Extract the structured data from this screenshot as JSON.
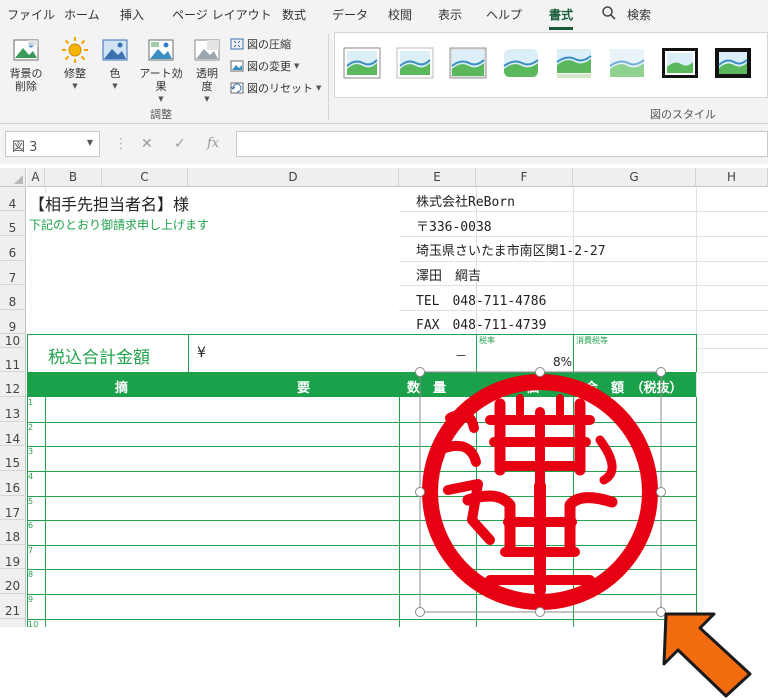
{
  "ribbon": {
    "tabs": [
      "ファイル",
      "ホーム",
      "挿入",
      "ページ レイアウト",
      "数式",
      "データ",
      "校閲",
      "表示",
      "ヘルプ",
      "書式"
    ],
    "search": "検索",
    "buttons": {
      "remove_bg_1": "背景の",
      "remove_bg_2": "削除",
      "corrections": "修整",
      "color": "色",
      "artistic": "アート効果",
      "transparency_1": "透明",
      "transparency_2": "度"
    },
    "small_buttons": [
      "図の圧縮",
      "図の変更",
      "図のリセット"
    ],
    "groups": {
      "adjust": "調整",
      "styles": "図のスタイル"
    }
  },
  "formula_bar": {
    "name_box": "図 3",
    "cancel": "✕",
    "enter": "✓",
    "fx": "fx",
    "formula": ""
  },
  "columns": [
    "A",
    "B",
    "C",
    "D",
    "E",
    "F",
    "G",
    "H"
  ],
  "rows": [
    "4",
    "5",
    "6",
    "7",
    "8",
    "9",
    "10",
    "11",
    "12",
    "13",
    "14",
    "15",
    "16",
    "17",
    "18",
    "19",
    "20",
    "21"
  ],
  "sheet": {
    "recipient": "【相手先担当者名】様",
    "greeting": "下記のとおり御請求申し上げます",
    "company": "株式会社ReBorn",
    "postal": "〒336-0038",
    "address": "埼玉県さいたま市南区関1-2-27",
    "person": "澤田　綱吉",
    "tel": "TEL　048-711-4786",
    "fax": "FAX　048-711-4739",
    "total_label": "税込合計金額",
    "yen": "¥",
    "dash": "－",
    "tax_rate_label": "税率",
    "consumption_tax_label": "消費税等",
    "tax_rate": "8%",
    "headers": {
      "summary_1": "摘",
      "summary_2": "要",
      "qty": "数　量",
      "price": "単　価",
      "amount": "金　額　（税抜）"
    },
    "item_numbers": [
      "1",
      "2",
      "3",
      "4",
      "5",
      "6",
      "7",
      "8",
      "9",
      "10"
    ]
  },
  "colors": {
    "accent": "#1aa14a",
    "stamp": "#e60012",
    "arrow": "#f26b0f",
    "tab_active": "#185c37"
  }
}
